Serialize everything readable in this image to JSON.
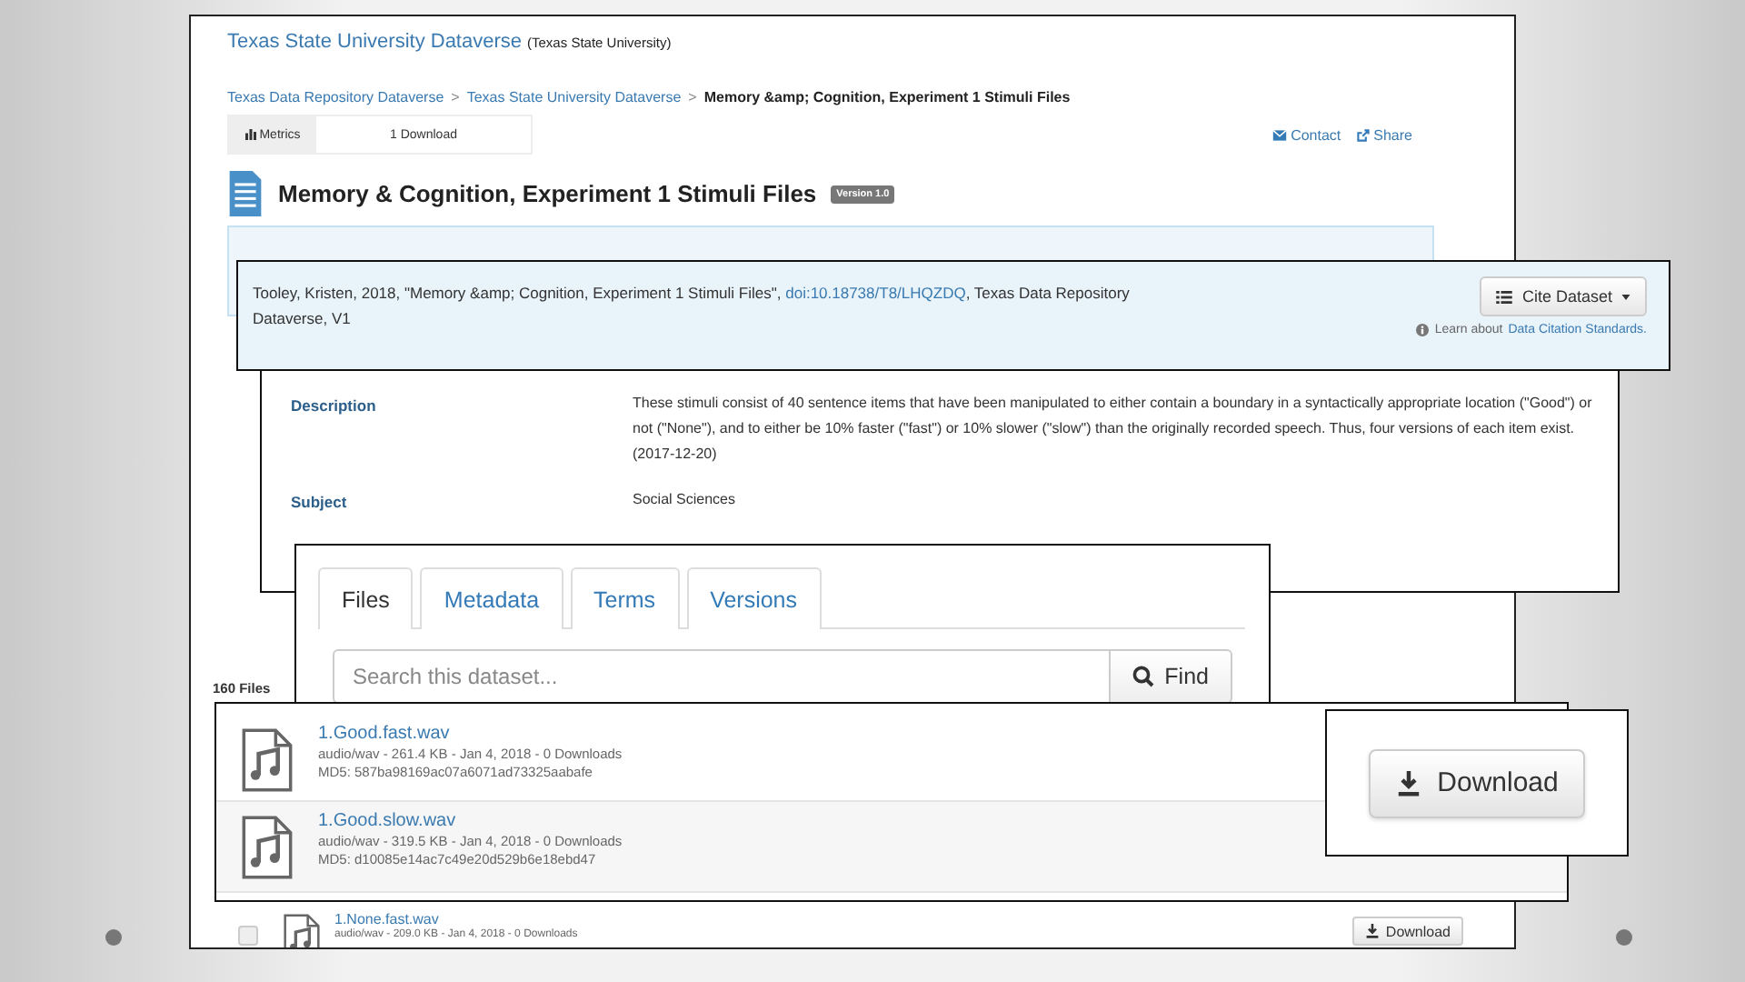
{
  "site": {
    "title": "Texas State University Dataverse",
    "affiliation": "(Texas State University)"
  },
  "breadcrumb": [
    {
      "label": "Texas Data Repository Dataverse",
      "kind": "link"
    },
    {
      "label": "Texas State University Dataverse",
      "kind": "link",
      "separator": ">"
    },
    {
      "label": "Memory &amp; Cognition, Experiment 1 Stimuli Files",
      "kind": "current",
      "separator": ">"
    }
  ],
  "metrics_tabs": [
    {
      "label": "Metrics",
      "selected": true
    },
    {
      "label": "1 Download",
      "selected": false
    }
  ],
  "actions": [
    {
      "label": "Contact",
      "kind": "mail"
    },
    {
      "label": "Share",
      "kind": "share"
    }
  ],
  "dataset": {
    "title": "Memory & Cognition, Experiment 1 Stimuli Files",
    "version": "Version 1.0"
  },
  "citation": {
    "before": "Tooley, Kristen, 2018, \"Memory &amp; Cognition, Experiment 1 Stimuli Files\", ",
    "doi": "doi:10.18738/T8/LHQZDQ",
    "after": ", Texas Data Repository Dataverse, V1",
    "button": "Cite Dataset",
    "learn": "Learn about",
    "learn_link": "Data Citation Standards."
  },
  "metadata": [
    {
      "label": "Description",
      "value": "These stimuli consist of 40 sentence items that have been manipulated to either contain a boundary in a syntactically appropriate location (\"Good\") or not (\"None\"), and to either be 10% faster (\"fast\") or 10% slower (\"slow\") than the originally recorded speech. Thus, four versions of each item exist. (2017-12-20)"
    },
    {
      "label": "Subject",
      "value": "Social Sciences"
    }
  ],
  "file_tabs": [
    {
      "label": "Files",
      "selected": true
    },
    {
      "label": "Metadata",
      "selected": false
    },
    {
      "label": "Terms",
      "selected": false
    },
    {
      "label": "Versions",
      "selected": false
    }
  ],
  "search": {
    "placeholder": "Search this dataset...",
    "button": "Find"
  },
  "file_count": "160 Files",
  "files": [
    {
      "name": "1.Good.fast.wav",
      "info": "audio/wav - 261.4 KB - Jan 4, 2018 - 0 Downloads",
      "md5": "MD5: 587ba98169ac07a6071ad73325aabafe"
    },
    {
      "name": "1.Good.slow.wav",
      "info": "audio/wav - 319.5 KB - Jan 4, 2018 - 0 Downloads",
      "md5": "MD5: d10085e14ac7c49e20d529b6e18ebd47"
    }
  ],
  "background_file": {
    "checked": false,
    "name": "1.None.fast.wav",
    "info": "audio/wav - 209.0 KB - Jan 4, 2018 - 0 Downloads",
    "button": "Download"
  },
  "download_zoom": {
    "button": "Download"
  }
}
